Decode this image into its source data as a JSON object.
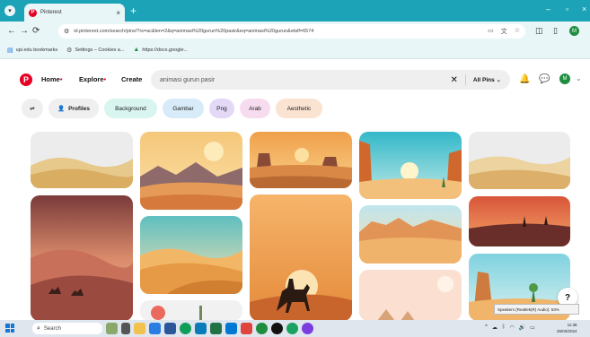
{
  "browser": {
    "tab_title": "Pinterest",
    "url": "id.pinterest.com/search/pins/?rs=ac&len=2&q=animasi%20gurun%20pasir&eq=animasi%20gurun&etslf=6574",
    "bookmarks": [
      {
        "label": "upi.edu bookmarks"
      },
      {
        "label": "Settings – Cookies a..."
      },
      {
        "label": "https://docs.google..."
      }
    ],
    "profile_initial": "M"
  },
  "pinterest": {
    "nav": {
      "home": "Home",
      "explore": "Explore",
      "create": "Create"
    },
    "search_query": "animasi gurun pasir",
    "scope_label": "All Pins",
    "avatar_initial": "M",
    "filters": [
      {
        "label": "Profiles",
        "bg": "#efefef"
      },
      {
        "label": "Background",
        "bg": "#d8f5f0"
      },
      {
        "label": "Gambar",
        "bg": "#d7ecf8"
      },
      {
        "label": "Png",
        "bg": "#e3d9f6"
      },
      {
        "label": "Arab",
        "bg": "#f6dcee"
      },
      {
        "label": "Aesthetic",
        "bg": "#fbe3d2"
      }
    ]
  },
  "overlay": {
    "help_label": "?",
    "volume_tooltip": "Speakers (Realtek(R) Audio): 53%"
  },
  "taskbar": {
    "search_label": "Search",
    "time": "11:38",
    "date": "25/03/2024"
  },
  "colors": {
    "brand": "#e60023",
    "chrome_accent": "#1ca3b8"
  }
}
